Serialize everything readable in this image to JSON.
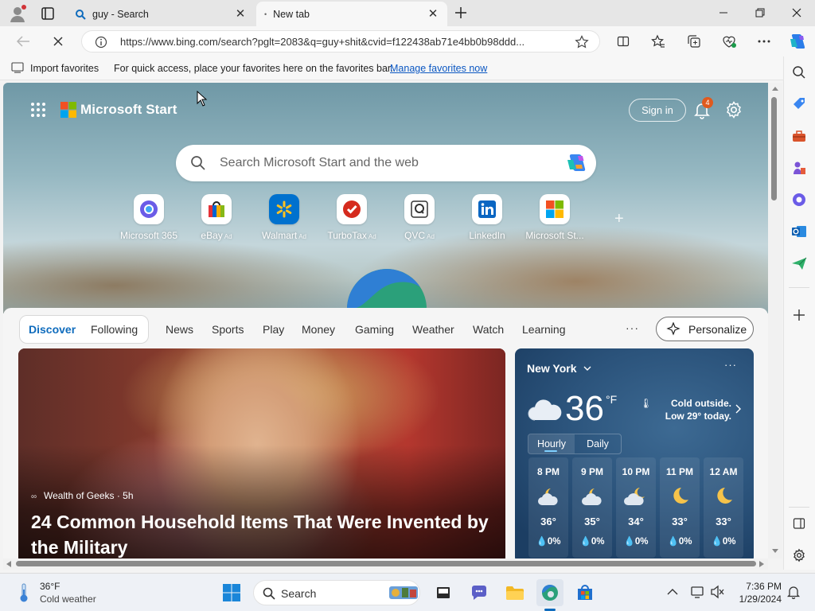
{
  "browser": {
    "tabs": [
      {
        "label": "guy - Search"
      },
      {
        "label": "New tab"
      }
    ],
    "address": {
      "url": "https://www.bing.com/search?pglt=2083&q=guy+shit&cvid=f122438ab71e4bb0b98ddd..."
    },
    "favorites_bar": {
      "import_label": "Import favorites",
      "hint": "For quick access, place your favorites here on the favorites bar.",
      "manage_link": "Manage favorites now"
    }
  },
  "start_page": {
    "brand": "Microsoft Start",
    "sign_in": "Sign in",
    "notification_count": "4",
    "search_placeholder": "Search Microsoft Start and the web",
    "quick_links": [
      {
        "label": "Microsoft 365",
        "ad": ""
      },
      {
        "label": "eBay",
        "ad": "Ad"
      },
      {
        "label": "Walmart",
        "ad": "Ad"
      },
      {
        "label": "TurboTax",
        "ad": "Ad"
      },
      {
        "label": "QVC",
        "ad": "Ad"
      },
      {
        "label": "LinkedIn",
        "ad": ""
      },
      {
        "label": "Microsoft St...",
        "ad": ""
      }
    ],
    "feed_nav": {
      "items": [
        "Discover",
        "Following",
        "News",
        "Sports",
        "Play",
        "Money",
        "Gaming",
        "Weather",
        "Watch",
        "Learning"
      ],
      "more": "···",
      "personalize": "Personalize"
    },
    "hero_article": {
      "source": "Wealth of Geeks · 5h",
      "title": "24 Common Household Items That Were Invented by the Military"
    },
    "weather": {
      "city": "New York",
      "temp": "36",
      "unit": "°F",
      "note": "Cold outside. Low 29° today.",
      "tabs": [
        "Hourly",
        "Daily"
      ],
      "hourly": [
        {
          "time": "8 PM",
          "temp": "36°",
          "precip": "0%",
          "icon": "partly-cloudy-night-icon"
        },
        {
          "time": "9 PM",
          "temp": "35°",
          "precip": "0%",
          "icon": "partly-cloudy-night-icon"
        },
        {
          "time": "10 PM",
          "temp": "34°",
          "precip": "0%",
          "icon": "partly-cloudy-night-icon"
        },
        {
          "time": "11 PM",
          "temp": "33°",
          "precip": "0%",
          "icon": "clear-night-icon"
        },
        {
          "time": "12 AM",
          "temp": "33°",
          "precip": "0%",
          "icon": "clear-night-icon"
        }
      ]
    }
  },
  "taskbar": {
    "weather_temp": "36°F",
    "weather_cond": "Cold weather",
    "search_label": "Search",
    "time": "7:36 PM",
    "date": "1/29/2024"
  },
  "colors": {
    "accent": "#0f6cbd",
    "badge": "#e05a1e",
    "weather_card": "#2b537b"
  }
}
